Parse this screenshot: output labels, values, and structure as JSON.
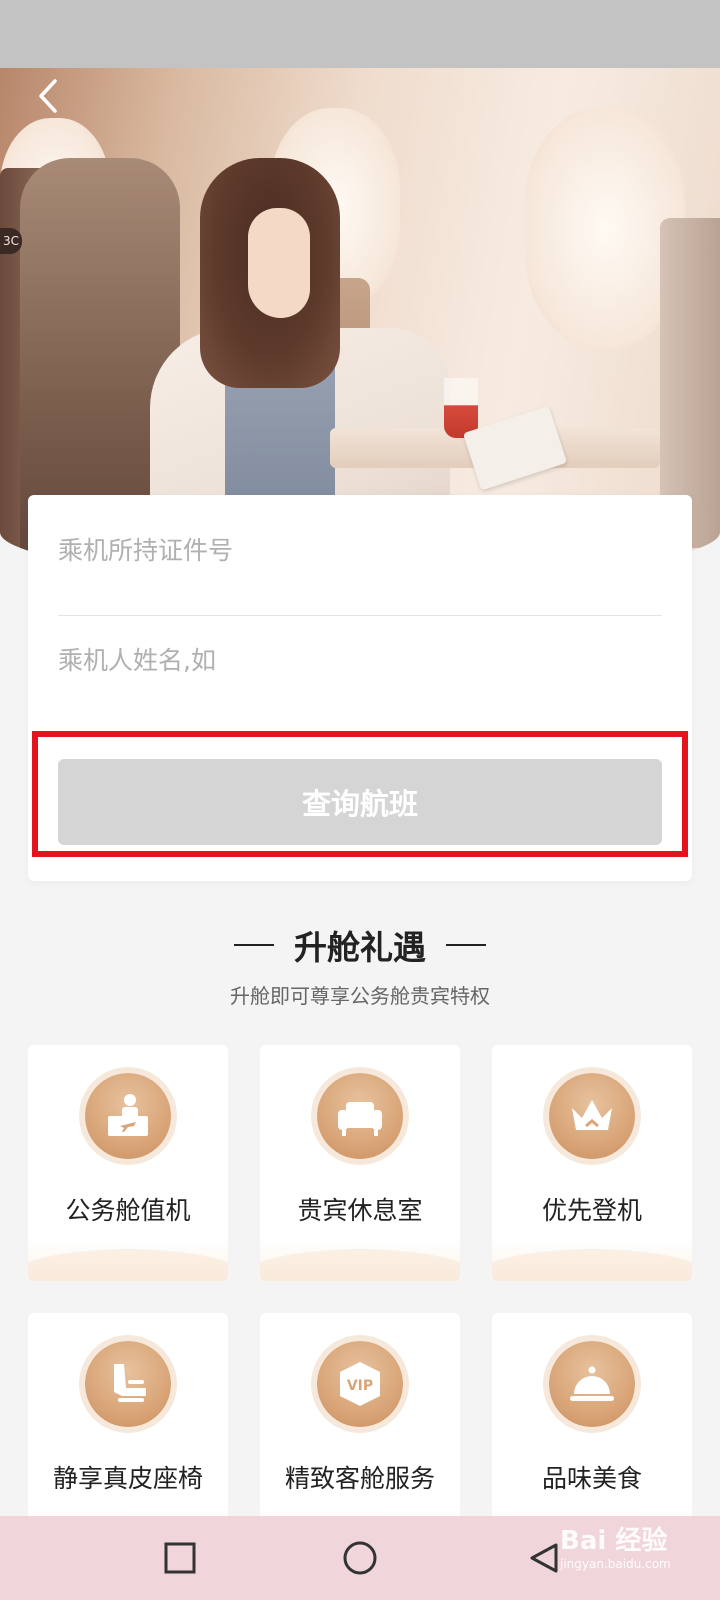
{
  "form": {
    "id_placeholder": "乘机所持证件号",
    "name_placeholder": "乘机人姓名,如",
    "query_button": "查询航班"
  },
  "section": {
    "title": "升舱礼遇",
    "subtitle": "升舱即可尊享公务舱贵宾特权"
  },
  "benefits": [
    {
      "label": "公务舱值机",
      "icon": "checkin-counter-icon"
    },
    {
      "label": "贵宾休息室",
      "icon": "sofa-icon"
    },
    {
      "label": "优先登机",
      "icon": "crown-icon"
    },
    {
      "label": "静享真皮座椅",
      "icon": "seat-icon"
    },
    {
      "label": "精致客舱服务",
      "icon": "vip-badge-icon"
    },
    {
      "label": "品味美食",
      "icon": "food-cloche-icon"
    }
  ],
  "hero": {
    "seat_tag": "3C"
  },
  "watermark": {
    "brand": "Bai 经验",
    "url": "jingyan.baidu.com"
  },
  "colors": {
    "highlight": "#e2141f",
    "button_disabled": "#d5d5d5",
    "icon_gold": "#d9a578",
    "nav_bar": "#f0d6da"
  }
}
